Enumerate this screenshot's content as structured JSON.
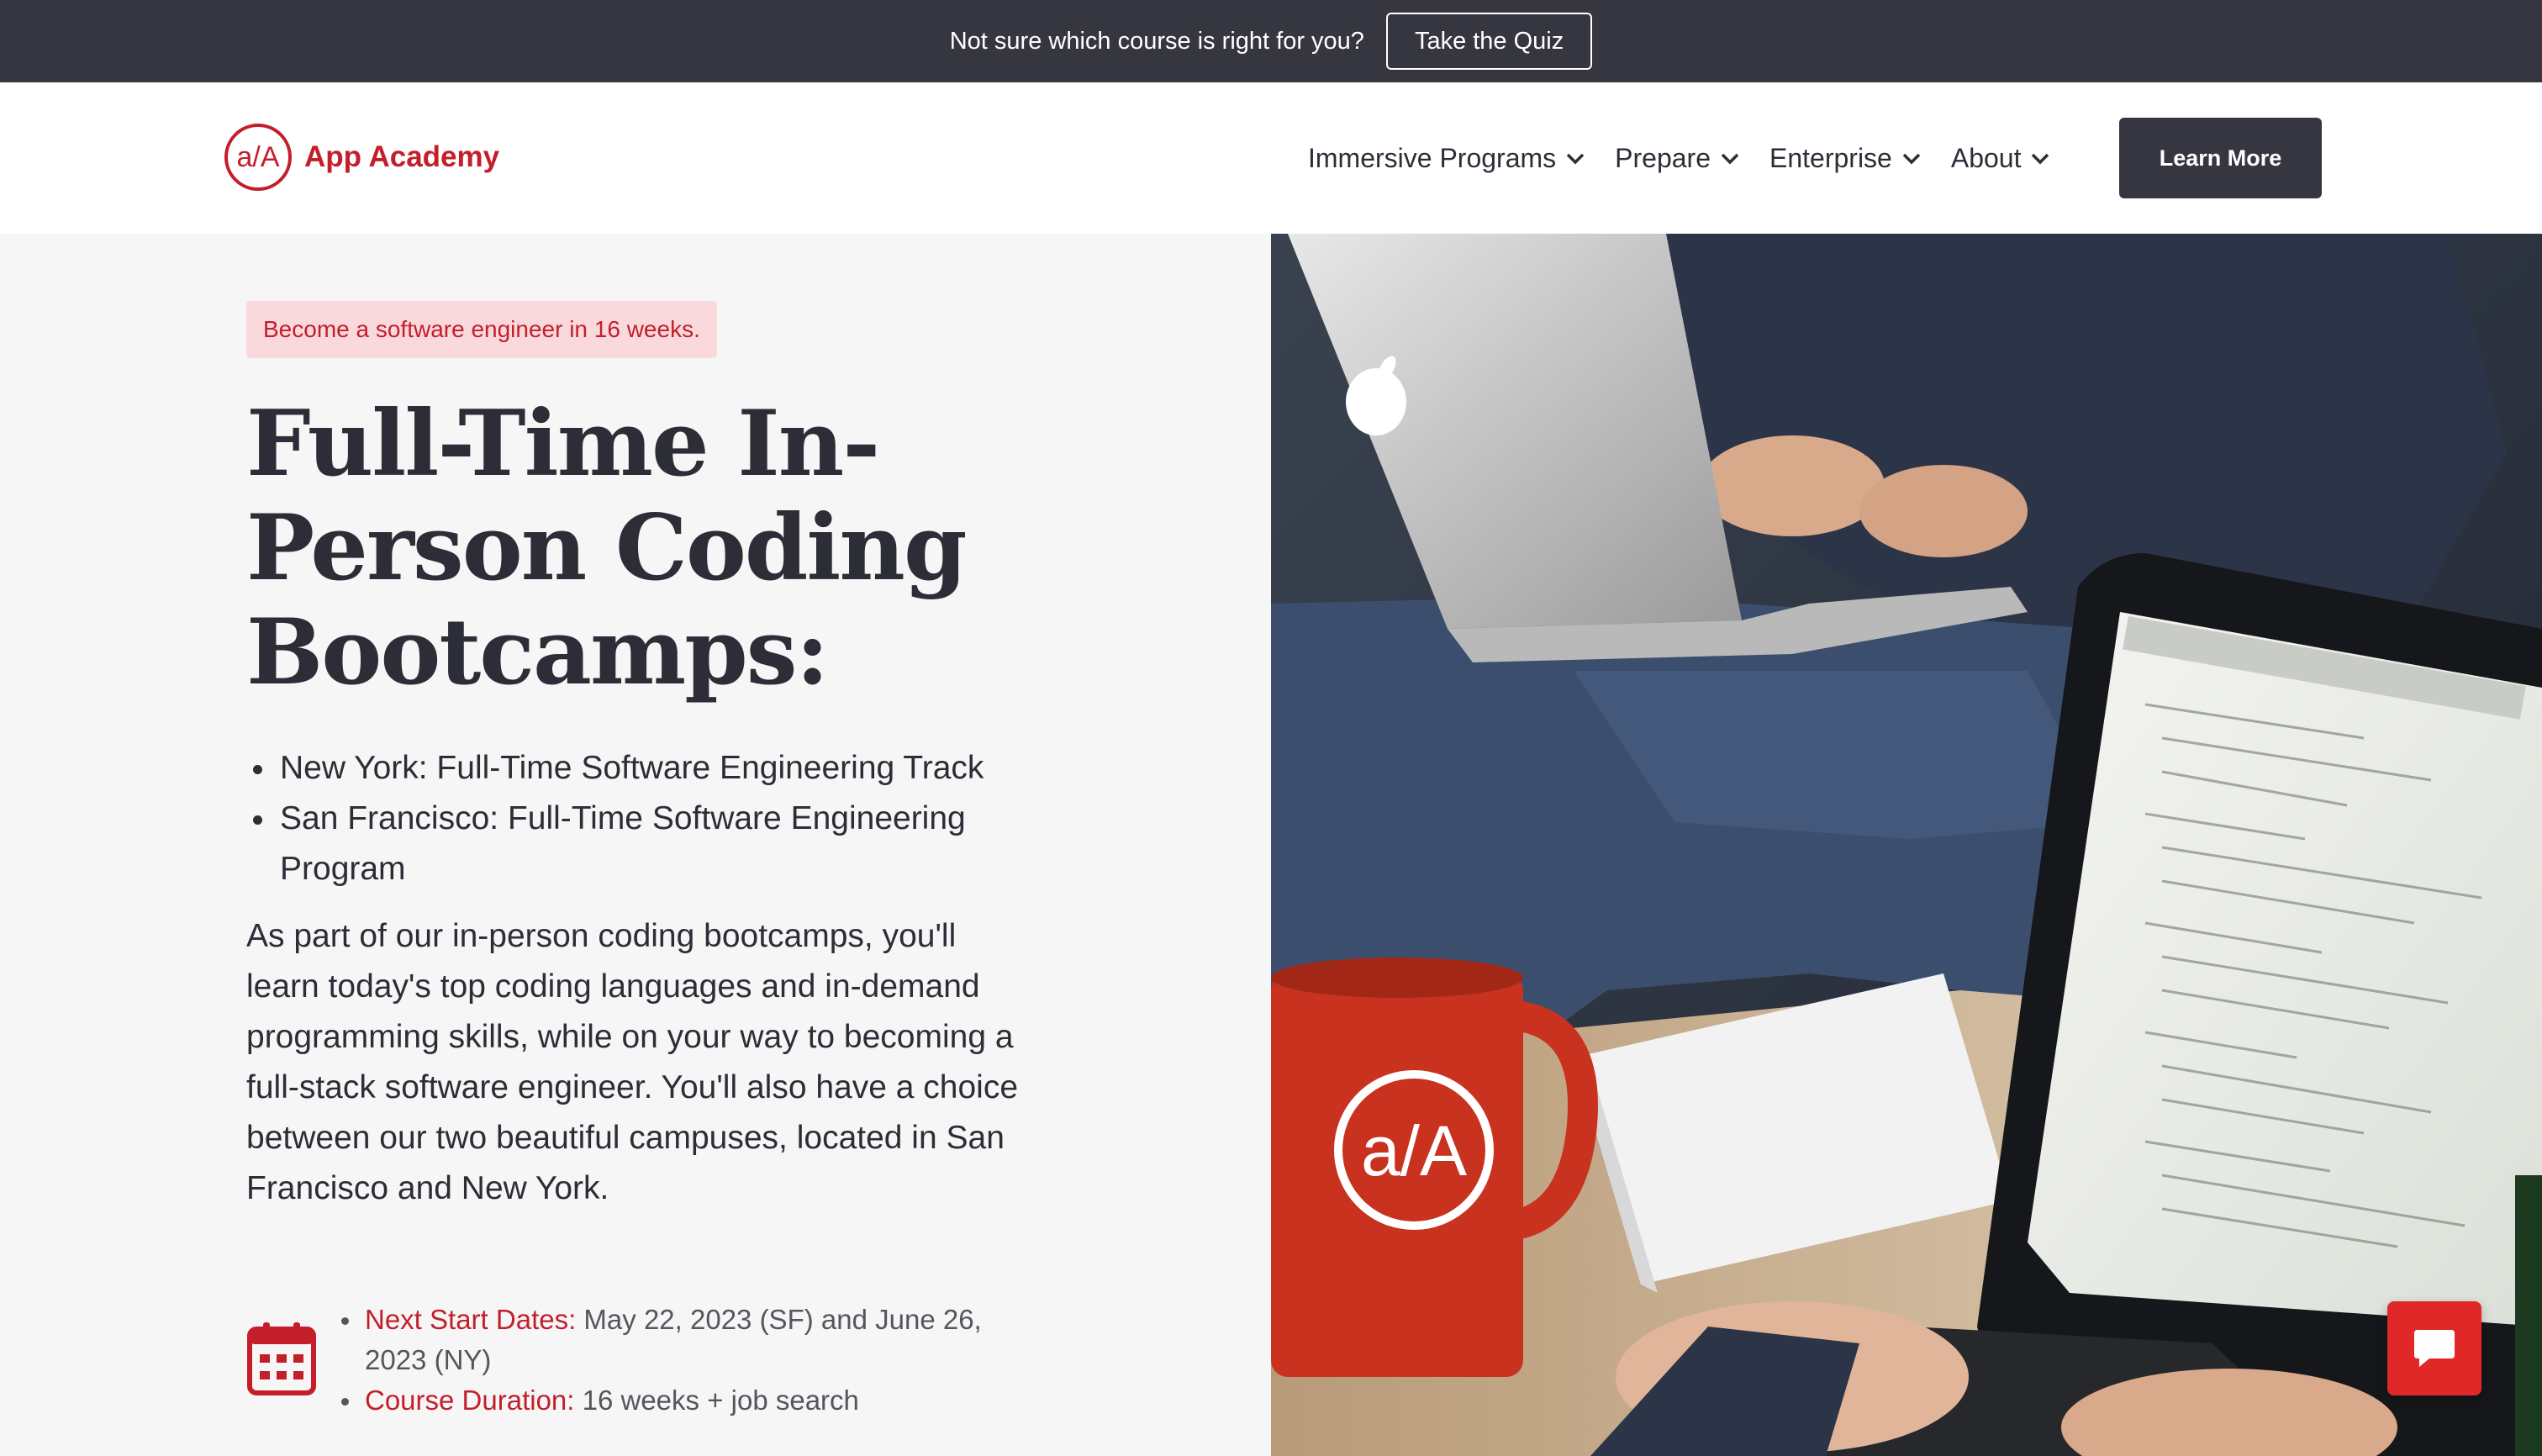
{
  "banner": {
    "text": "Not sure which course is right for you?",
    "quiz_label": "Take the Quiz"
  },
  "header": {
    "logo_text": "App Academy",
    "logo_mark": "a/A",
    "nav": [
      {
        "label": "Immersive Programs",
        "icon": "chevron-down-icon"
      },
      {
        "label": "Prepare",
        "icon": "chevron-down-icon"
      },
      {
        "label": "Enterprise",
        "icon": "chevron-down-icon"
      },
      {
        "label": "About",
        "icon": "chevron-down-icon"
      }
    ],
    "cta_label": "Learn More"
  },
  "hero": {
    "eyebrow": "Become a software engineer in 16 weeks.",
    "title_lines": [
      "Full-Time In-",
      "Person Coding",
      "Bootcamps:"
    ],
    "tracks": [
      "New York: Full-Time Software Engineering Track",
      "San Francisco: Full-Time Software Engineering Program"
    ],
    "description": "As part of our in-person coding bootcamps, you'll learn today's top coding languages and in-demand programming skills, while on your way to becoming a full-stack software engineer. You'll also have a choice between our two beautiful campuses, located in San Francisco and New York.",
    "facts": [
      {
        "label": "Next Start Dates:",
        "value": " May 22, 2023 (SF) and June 26, 2023 (NY)"
      },
      {
        "label": "Course Duration:",
        "value": " 16 weeks + job search"
      }
    ],
    "mug_logo": "a/A"
  },
  "colors": {
    "brand_red": "#c41e2b",
    "dark": "#363641",
    "panel_bg": "#f6f6f6",
    "eyebrow_bg": "#f9d9dc",
    "chat_red": "#e02828"
  },
  "chat": {
    "icon": "chat-bubble-icon"
  }
}
